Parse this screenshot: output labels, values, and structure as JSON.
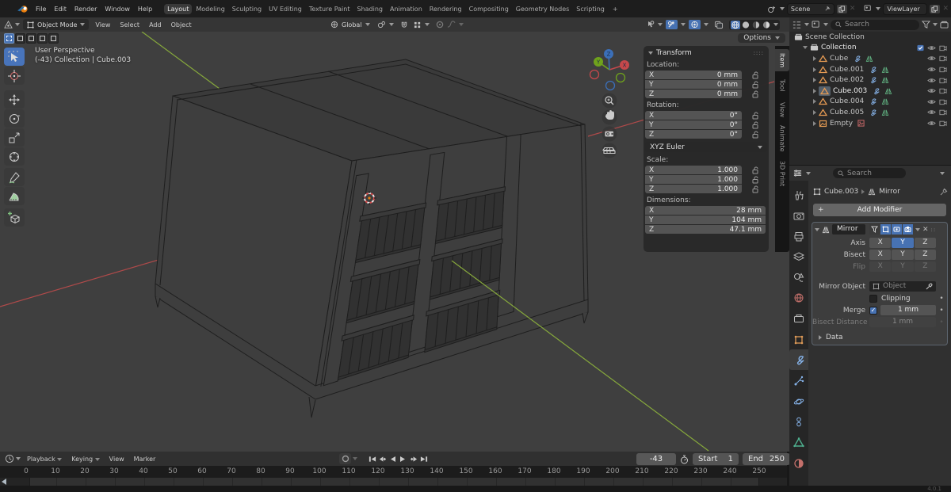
{
  "topbar": {
    "menus": [
      "File",
      "Edit",
      "Render",
      "Window",
      "Help"
    ],
    "tabs": [
      "Layout",
      "Modeling",
      "Sculpting",
      "UV Editing",
      "Texture Paint",
      "Shading",
      "Animation",
      "Rendering",
      "Compositing",
      "Geometry Nodes",
      "Scripting"
    ],
    "active_tab": "Layout",
    "new_workspace_button": "+",
    "scene_label": "Scene",
    "view_layer_label": "ViewLayer"
  },
  "viewport_header": {
    "mode": "Object Mode",
    "menus": [
      "View",
      "Select",
      "Add",
      "Object"
    ],
    "orientation": "Global"
  },
  "viewport": {
    "overlay_line1": "User Perspective",
    "overlay_line2": "(-43) Collection | Cube.003",
    "options_label": "Options",
    "gizmo_axis_labels": [
      "X",
      "Y",
      "Z"
    ]
  },
  "npanel": {
    "title": "Transform",
    "tabs": [
      "Item",
      "Tool",
      "View",
      "Animate",
      "3D Print"
    ],
    "active_tab": "Item",
    "sections": [
      {
        "label": "Location:",
        "locks": true,
        "rows": [
          [
            "X",
            "0 mm"
          ],
          [
            "Y",
            "0 mm"
          ],
          [
            "Z",
            "0 mm"
          ]
        ]
      },
      {
        "label": "Rotation:",
        "locks": true,
        "rows": [
          [
            "X",
            "0°"
          ],
          [
            "Y",
            "0°"
          ],
          [
            "Z",
            "0°"
          ]
        ],
        "after_dropdown": "XYZ Euler"
      },
      {
        "label": "Scale:",
        "locks": true,
        "rows": [
          [
            "X",
            "1.000"
          ],
          [
            "Y",
            "1.000"
          ],
          [
            "Z",
            "1.000"
          ]
        ]
      },
      {
        "label": "Dimensions:",
        "locks": false,
        "rows": [
          [
            "X",
            "28 mm"
          ],
          [
            "Y",
            "104 mm"
          ],
          [
            "Z",
            "47.1 mm"
          ]
        ]
      }
    ]
  },
  "outliner": {
    "search_placeholder": "Search",
    "rows": [
      {
        "label": "Scene Collection",
        "depth": 0,
        "icon": "collection",
        "expand": "none",
        "toggles": []
      },
      {
        "label": "Collection",
        "depth": 1,
        "icon": "collection",
        "expand": "down",
        "toggles": [
          "check",
          "eye",
          "camera"
        ]
      },
      {
        "label": "Cube",
        "depth": 2,
        "icon": "mesh",
        "expand": "right",
        "badges": [
          "wrench",
          "mirror"
        ],
        "toggles": [
          "eye",
          "camera"
        ]
      },
      {
        "label": "Cube.001",
        "depth": 2,
        "icon": "mesh",
        "expand": "right",
        "badges": [
          "wrench",
          "mirror"
        ],
        "toggles": [
          "eye",
          "camera"
        ]
      },
      {
        "label": "Cube.002",
        "depth": 2,
        "icon": "mesh",
        "expand": "right",
        "badges": [
          "wrench",
          "mirror"
        ],
        "toggles": [
          "eye",
          "camera"
        ]
      },
      {
        "label": "Cube.003",
        "depth": 2,
        "icon": "mesh",
        "expand": "right",
        "selected": true,
        "badges": [
          "wrench",
          "mirror"
        ],
        "toggles": [
          "eye",
          "camera"
        ]
      },
      {
        "label": "Cube.004",
        "depth": 2,
        "icon": "mesh",
        "expand": "right",
        "badges": [
          "wrench",
          "mirror"
        ],
        "toggles": [
          "eye",
          "camera"
        ]
      },
      {
        "label": "Cube.005",
        "depth": 2,
        "icon": "mesh",
        "expand": "right",
        "badges": [
          "wrench",
          "mirror"
        ],
        "toggles": [
          "eye",
          "camera"
        ]
      },
      {
        "label": "Empty",
        "depth": 2,
        "icon": "empty",
        "expand": "right",
        "badges": [
          "image"
        ],
        "toggles": [
          "eye",
          "camera"
        ]
      }
    ]
  },
  "properties": {
    "search_placeholder": "Search",
    "breadcrumb_object": "Cube.003",
    "breadcrumb_modifier": "Mirror",
    "add_modifier_label": "Add Modifier",
    "tabs": [
      "tool",
      "render",
      "output",
      "viewlayer",
      "scene",
      "world",
      "collection",
      "object",
      "modifier",
      "particles",
      "physics",
      "constraints",
      "data",
      "material"
    ],
    "active_prop_tab": "modifier",
    "modifier": {
      "name": "Mirror",
      "axis_label": "Axis",
      "bisect_label": "Bisect",
      "flip_label": "Flip",
      "axis_options": [
        "X",
        "Y",
        "Z"
      ],
      "axis_active": "Y",
      "mirror_object_label": "Mirror Object",
      "mirror_object_placeholder": "Object",
      "clipping_label": "Clipping",
      "merge_label": "Merge",
      "merge_value": "1 mm",
      "bisect_distance_label": "Bisect Distance",
      "bisect_distance_value": "1 mm",
      "data_label": "Data"
    }
  },
  "timeline": {
    "menus": [
      "Playback",
      "Keying",
      "View",
      "Marker"
    ],
    "tick_start": 0,
    "tick_end": 250,
    "tick_step": 10,
    "current_frame": "-43",
    "start_label": "Start",
    "start_value": "1",
    "end_label": "End",
    "end_value": "250"
  },
  "status": {
    "version": "4.0.1"
  }
}
